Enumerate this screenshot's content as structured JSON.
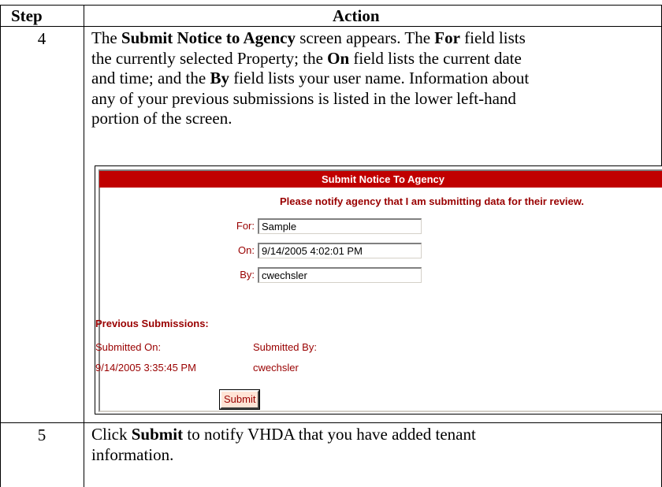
{
  "table": {
    "header_step": "Step",
    "header_action": "Action"
  },
  "rows": [
    {
      "step": "4",
      "lines": [
        [
          "The ",
          {
            "b": "Submit Notice to Agency"
          },
          " screen appears. The ",
          {
            "b": "For"
          },
          " field lists"
        ],
        [
          "the currently selected Property; the ",
          {
            "b": "On"
          },
          " field lists the current date"
        ],
        [
          "and time; and the ",
          {
            "b": "By"
          },
          " field lists your user name. Information about"
        ],
        [
          "any of your previous submissions is listed in the lower left-hand"
        ],
        [
          "portion of the screen."
        ]
      ]
    },
    {
      "step": "5",
      "lines": [
        [
          "Click ",
          {
            "b": "Submit"
          },
          " to notify VHDA that you have added tenant"
        ],
        [
          "information."
        ]
      ]
    }
  ],
  "screen": {
    "title": "Submit Notice To Agency",
    "notify_text": "Please notify agency that I am submitting data for their review.",
    "fields": [
      {
        "label": "For:",
        "value": "Sample"
      },
      {
        "label": "On:",
        "value": "9/14/2005 4:02:01 PM"
      },
      {
        "label": "By:",
        "value": "cwechsler"
      }
    ],
    "previous_header": "Previous Submissions:",
    "columns": [
      "Submitted On:",
      "Submitted By:"
    ],
    "submissions": [
      {
        "on": "9/14/2005 3:35:45 PM",
        "by": "cwechsler"
      }
    ],
    "submit_label": "Submit",
    "colors": {
      "title_bar": "#c00000",
      "text": "#990000"
    }
  }
}
